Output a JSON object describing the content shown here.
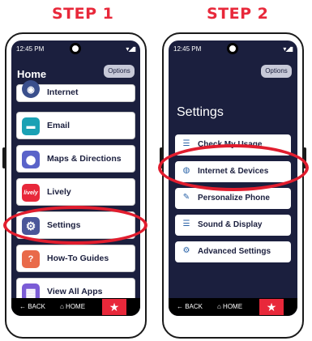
{
  "steps": {
    "step1": "STEP 1",
    "step2": "STEP 2"
  },
  "colors": {
    "accent": "#e8283a",
    "screen_bg": "#1b1f3e",
    "card_bg": "#ffffff"
  },
  "phone1": {
    "time": "12:45 PM",
    "signal": "▾◢▮",
    "title": "Home",
    "options_label": "Options",
    "apps": [
      {
        "label": "Internet",
        "icon": "globe-icon",
        "glyph": "◉",
        "color": "#3a4f8c"
      },
      {
        "label": "Email",
        "icon": "email-icon",
        "glyph": "▬",
        "color": "#1aa1b4"
      },
      {
        "label": "Maps & Directions",
        "icon": "map-pin-icon",
        "glyph": "⬤",
        "color": "#5a63c9"
      },
      {
        "label": "Lively",
        "icon": "lively-logo-icon",
        "glyph": "lively",
        "color": "#e8283a"
      },
      {
        "label": "Settings",
        "icon": "gear-icon",
        "glyph": "⚙",
        "color": "#4a5699"
      },
      {
        "label": "How-To Guides",
        "icon": "question-icon",
        "glyph": "?",
        "color": "#e96a4a"
      },
      {
        "label": "View All Apps",
        "icon": "grid-icon",
        "glyph": "▦",
        "color": "#7b5cd6"
      }
    ],
    "nav": {
      "back": "← BACK",
      "home": "⌂ HOME",
      "star": "★"
    }
  },
  "phone2": {
    "time": "12:45 PM",
    "signal": "▾◢▮",
    "title": "Settings",
    "options_label": "Options",
    "items": [
      {
        "label": "Check My Usage",
        "icon": "usage-icon",
        "glyph": "☰"
      },
      {
        "label": "Internet & Devices",
        "icon": "globe-icon",
        "glyph": "◍"
      },
      {
        "label": "Personalize Phone",
        "icon": "personalize-icon",
        "glyph": "✎"
      },
      {
        "label": "Sound & Display",
        "icon": "sliders-icon",
        "glyph": "☰"
      },
      {
        "label": "Advanced Settings",
        "icon": "gear-icon",
        "glyph": "⚙"
      }
    ],
    "nav": {
      "back": "← BACK",
      "home": "⌂ HOME",
      "star": "★"
    }
  }
}
